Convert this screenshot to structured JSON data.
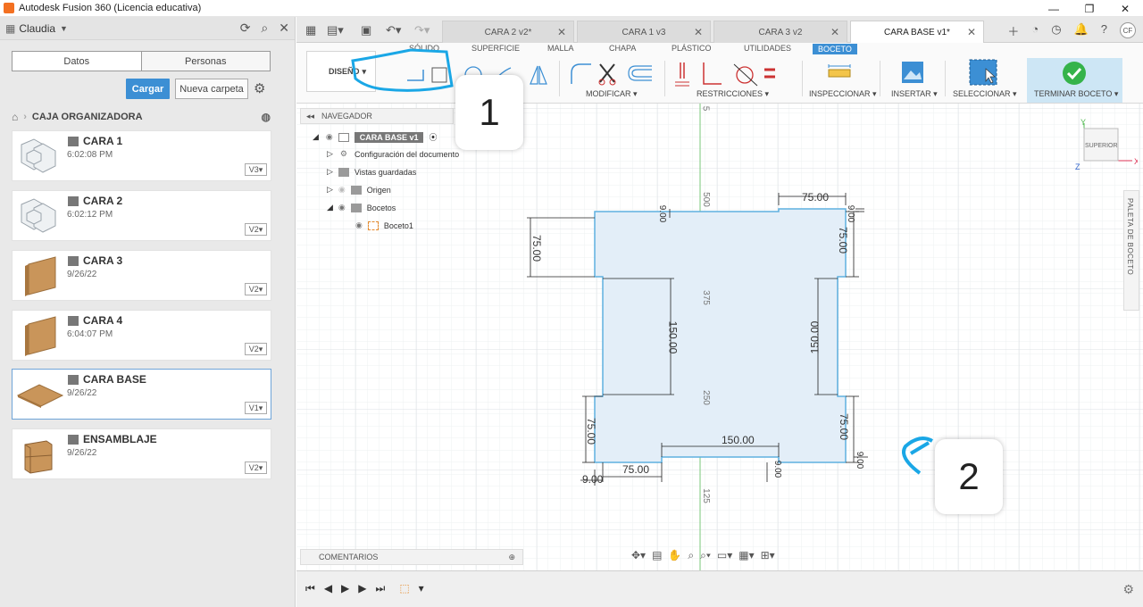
{
  "window": {
    "title": "Autodesk Fusion 360 (Licencia educativa)",
    "controls": [
      "—",
      "❐",
      "✕"
    ]
  },
  "data_panel": {
    "user": "Claudia",
    "tabs": [
      "Datos",
      "Personas"
    ],
    "upload_label": "Cargar",
    "new_folder_label": "Nueva carpeta",
    "project": "CAJA ORGANIZADORA",
    "files": [
      {
        "name": "CARA 1",
        "date": "6:02:08 PM",
        "version": "V3▾"
      },
      {
        "name": "CARA 2",
        "date": "6:02:12 PM",
        "version": "V2▾"
      },
      {
        "name": "CARA 3",
        "date": "9/26/22",
        "version": "V2▾"
      },
      {
        "name": "CARA 4",
        "date": "6:04:07 PM",
        "version": "V2▾"
      },
      {
        "name": "CARA BASE",
        "date": "9/26/22",
        "version": "V1▾"
      },
      {
        "name": "ENSAMBLAJE",
        "date": "9/26/22",
        "version": "V2▾"
      }
    ]
  },
  "doc_tabs": [
    {
      "label": "CARA 2 v2*"
    },
    {
      "label": "CARA 1 v3"
    },
    {
      "label": "CARA 3 v2"
    },
    {
      "label": "CARA BASE v1*"
    }
  ],
  "avatar_initials": "CF",
  "toolbar": {
    "workspace_tabs": [
      "SÓLIDO",
      "SUPERFICIE",
      "MALLA",
      "CHAPA",
      "PLÁSTICO",
      "UTILIDADES",
      "BOCETO"
    ],
    "design_label": "DISEÑO",
    "groups": {
      "modify": "MODIFICAR ▾",
      "constraints": "RESTRICCIONES ▾",
      "inspect": "INSPECCIONAR ▾",
      "insert": "INSERTAR ▾",
      "select": "SELECCIONAR ▾",
      "finish": "TERMINAR BOCETO ▾"
    }
  },
  "browser": {
    "header": "NAVEGADOR",
    "root": "CARA BASE v1",
    "items": [
      "Configuración del documento",
      "Vistas guardadas",
      "Origen",
      "Bocetos"
    ],
    "sketch": "Boceto1"
  },
  "comments_label": "COMENTARIOS",
  "palette_label": "PALETA DE BOCETO",
  "viewcube_label": "SUPERIOR",
  "grid_labels": [
    "5",
    "500",
    "375",
    "250",
    "125"
  ],
  "dimensions": [
    "75.00",
    "75.00",
    "75.00",
    "150.00",
    "150.00",
    "75.00",
    "75.00",
    "150.00",
    "75.00",
    "9.00",
    "9.00",
    "9.00",
    "9.00",
    "9.00"
  ],
  "callouts": [
    "1",
    "2"
  ],
  "colors": {
    "accent": "#3c8fd4",
    "sketch_fill": "#e3eef8",
    "sketch_line": "#5fb0df",
    "annotation": "#1aa7e6",
    "finish_check": "#35b34a"
  }
}
